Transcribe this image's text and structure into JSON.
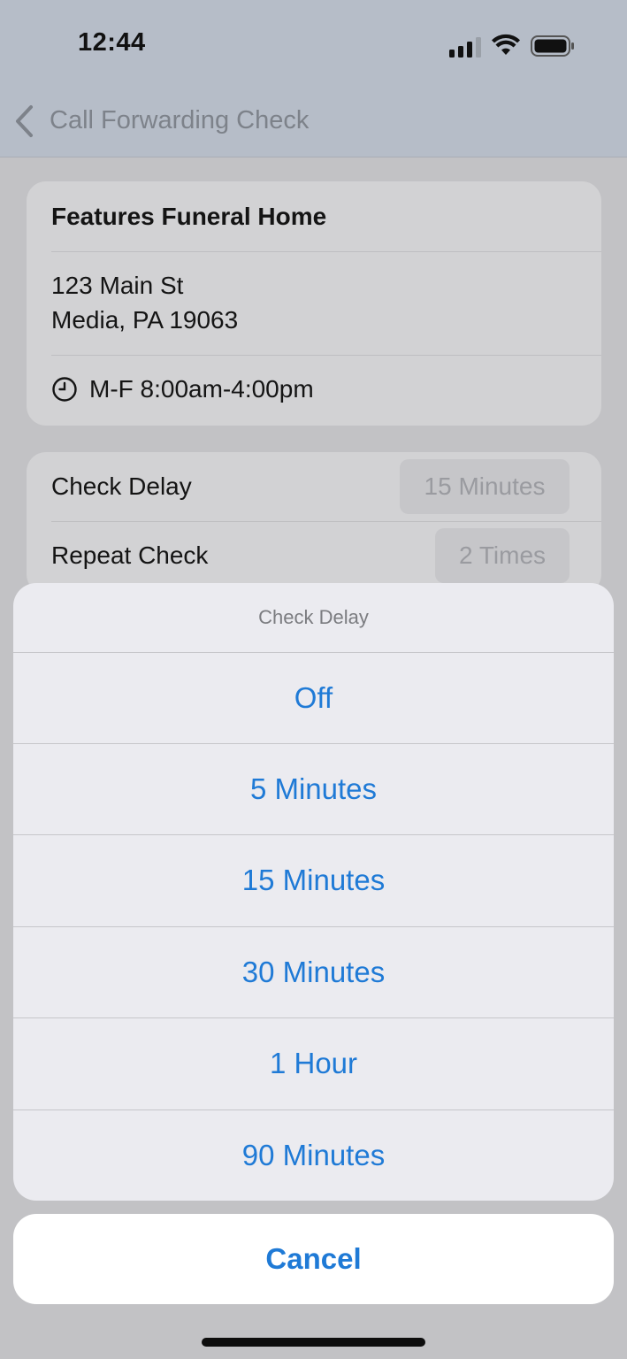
{
  "status_bar": {
    "time": "12:44"
  },
  "nav": {
    "back_title": "Call Forwarding Check"
  },
  "location": {
    "name": "Features Funeral Home",
    "address_line1": "123 Main St",
    "address_line2": "Media, PA 19063",
    "hours": "M-F 8:00am-4:00pm"
  },
  "settings": {
    "check_delay_label": "Check Delay",
    "check_delay_value": "15 Minutes",
    "repeat_check_label": "Repeat Check",
    "repeat_check_value": "2 Times"
  },
  "action_sheet": {
    "title": "Check Delay",
    "options": [
      "Off",
      "5 Minutes",
      "15 Minutes",
      "30 Minutes",
      "1 Hour",
      "90 Minutes"
    ],
    "cancel_label": "Cancel"
  },
  "colors": {
    "accent": "#1f7ad6"
  }
}
